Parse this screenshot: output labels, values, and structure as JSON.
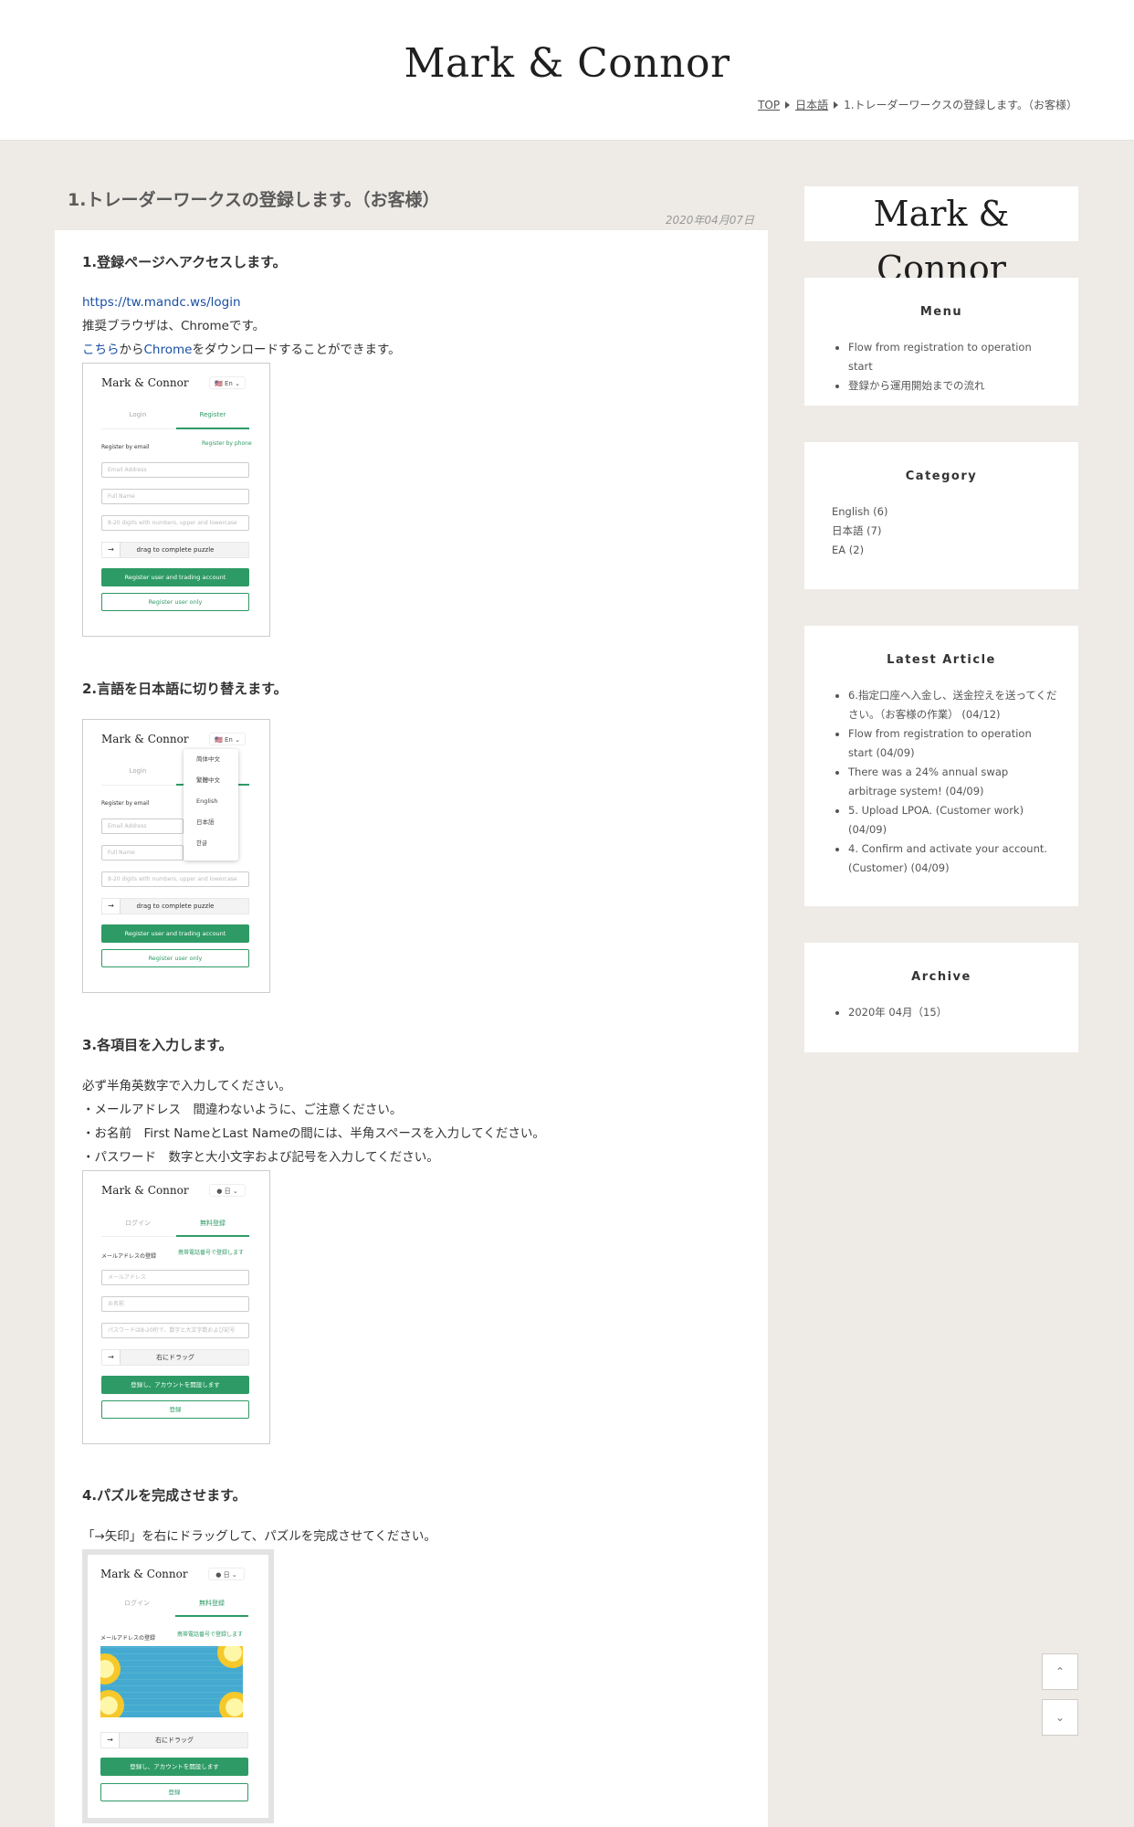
{
  "header": {
    "site_title": "Mark & Connor",
    "breadcrumb": [
      {
        "label": "TOP"
      },
      {
        "label": "日本語"
      },
      {
        "label": "1.トレーダーワークスの登録します。（お客様）"
      }
    ]
  },
  "post": {
    "title": "1.トレーダーワークスの登録します。（お客様）",
    "date": "2020年04月07日",
    "sections": {
      "s1": {
        "heading": "1.登録ページへアクセスします。",
        "url": "https://tw.mandc.ws/login",
        "browser_text": "推奨ブラウザは、Chromeです。",
        "download_link1": "こちら",
        "download_mid": "から",
        "download_link2": "Chrome",
        "download_tail": "をダウンロードすることができます。"
      },
      "s2": {
        "heading": "2.言語を日本語に切り替えます。"
      },
      "s3": {
        "heading": "3.各項目を入力します。",
        "lines": [
          "必ず半角英数字で入力してください。",
          "・メールアドレス　間違わないように、ご注意ください。",
          "・お名前　First NameとLast Nameの間には、半角スペースを入力してください。",
          "・パスワード　数字と大小文字および記号を入力してください。"
        ]
      },
      "s4": {
        "heading": "4.パズルを完成させます。",
        "text": "「→矢印」を右にドラッグして、パズルを完成させてください。"
      }
    },
    "shot_en": {
      "logo": "Mark & Connor",
      "lang": "🇺🇸 En ⌄",
      "tab_login": "Login",
      "tab_register": "Register",
      "by_email": "Register by email",
      "by_phone": "Register by phone",
      "email_ph": "Email Address",
      "name_ph": "Full Name",
      "pw_ph": "8-20 digits with numbers, upper and lowercase",
      "drag": "drag to complete puzzle",
      "btn_primary": "Register user and trading account",
      "btn_secondary": "Register user only",
      "languages": [
        "简体中文",
        "繁體中文",
        "English",
        "日本語",
        "한글"
      ]
    },
    "shot_ja": {
      "logo": "Mark & Connor",
      "lang": "● 日 ⌄",
      "tab_login": "ログイン",
      "tab_register": "無料登録",
      "by_email": "メールアドレスの登録",
      "by_phone": "携帯電話番号で登録します",
      "email_ph": "メールアドレス",
      "name_ph": "お名前",
      "pw_ph": "パスワードは8-20桁で、数字と大文字数および記号",
      "drag": "右にドラッグ",
      "btn_primary": "登録し、アカウントを開設します",
      "btn_secondary": "登録"
    }
  },
  "sidebar": {
    "logo": "Mark & Connor",
    "menu": {
      "title": "Menu",
      "items": [
        "Flow from registration to operation start",
        "登録から運用開始までの流れ"
      ]
    },
    "category": {
      "title": "Category",
      "items": [
        "English (6)",
        "日本語 (7)",
        "EA (2)"
      ]
    },
    "latest": {
      "title": "Latest Article",
      "items": [
        "6.指定口座へ入金し、送金控えを送ってください。（お客様の作業） (04/12)",
        "Flow from registration to operation start (04/09)",
        "There was a 24% annual swap arbitrage system! (04/09)",
        "5. Upload LPOA. (Customer work) (04/09)",
        "4. Confirm and activate your account. (Customer) (04/09)"
      ]
    },
    "archive": {
      "title": "Archive",
      "items": [
        "2020年 04月（15）"
      ]
    }
  },
  "controls": {
    "scroll_up": "⌃",
    "scroll_down": "⌄"
  },
  "colors": {
    "accent_green": "#2e9b66",
    "link_blue": "#1a4fa3",
    "page_bg": "#eeebe7"
  }
}
